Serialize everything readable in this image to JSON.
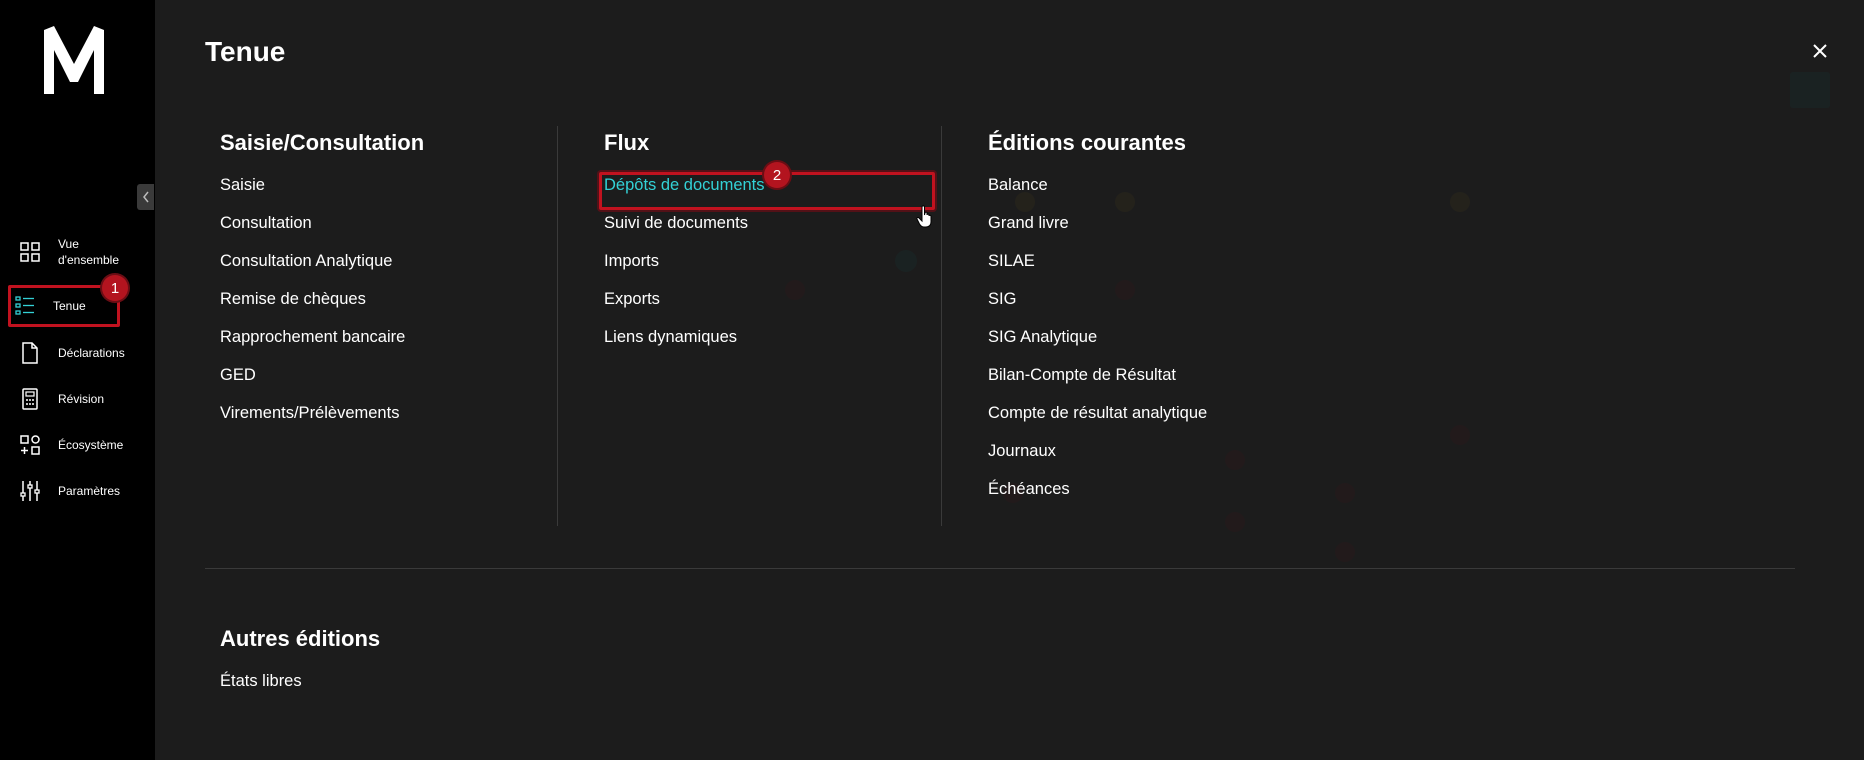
{
  "sidebar": {
    "items": [
      {
        "label": "Vue d'ensemble",
        "icon": "grid-icon"
      },
      {
        "label": "Tenue",
        "icon": "list-icon",
        "active": true
      },
      {
        "label": "Déclarations",
        "icon": "document-icon"
      },
      {
        "label": "Révision",
        "icon": "calculator-icon"
      },
      {
        "label": "Écosystème",
        "icon": "ecosystem-icon"
      },
      {
        "label": "Paramètres",
        "icon": "sliders-icon"
      }
    ],
    "badge": "1"
  },
  "panel": {
    "title": "Tenue",
    "columns": [
      {
        "heading": "Saisie/Consultation",
        "links": [
          "Saisie",
          "Consultation",
          "Consultation Analytique",
          "Remise de chèques",
          "Rapprochement bancaire",
          "GED",
          "Virements/Prélèvements"
        ]
      },
      {
        "heading": "Flux",
        "links": [
          "Dépôts de documents",
          "Suivi de documents",
          "Imports",
          "Exports",
          "Liens dynamiques"
        ],
        "badge": "2"
      },
      {
        "heading": "Éditions courantes",
        "links": [
          "Balance",
          "Grand livre",
          "SILAE",
          "SIG",
          "SIG Analytique",
          "Bilan-Compte de Résultat",
          "Compte de résultat analytique",
          "Journaux",
          "Échéances"
        ]
      },
      {
        "heading": "Autres éditions",
        "links": [
          "États libres"
        ]
      }
    ]
  },
  "colors": {
    "accent": "#33d1d6",
    "highlight_red": "#c1121f",
    "panel_bg": "#1c1c1c"
  }
}
